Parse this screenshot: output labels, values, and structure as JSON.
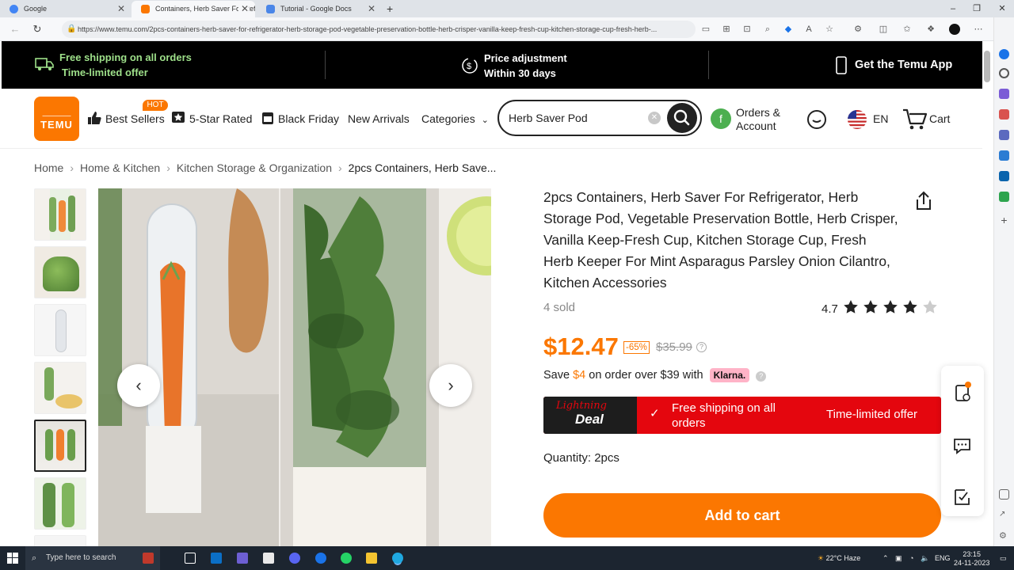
{
  "browser": {
    "tabs": [
      {
        "title": "Google",
        "favicon_color": "#4285f4",
        "active": false
      },
      {
        "title": "Containers, Herb Saver For Refrig",
        "favicon_color": "#fb7701",
        "active": true
      },
      {
        "title": "Tutorial - Google Docs",
        "favicon_color": "#4a86e8",
        "active": false
      }
    ],
    "new_tab": "+",
    "url": "https://www.temu.com/2pcs-containers-herb-saver-for-refrigerator-herb-storage-pod-vegetable-preservation-bottle-herb-crisper-vanilla-keep-fresh-cup-kitchen-storage-cup-fresh-herb-..."
  },
  "promo": {
    "shipping_title": "Free shipping on all orders",
    "shipping_sub": "Time-limited offer",
    "price_title": "Price adjustment",
    "price_sub": "Within 30 days",
    "app": "Get the Temu App"
  },
  "header": {
    "logo_top": "⸏⸏⸏",
    "logo_text": "TEMU",
    "hot_badge": "HOT",
    "nav": [
      "Best Sellers",
      "5-Star Rated",
      "Black Friday",
      "New Arrivals",
      "Categories"
    ],
    "search_value": "Herb Saver Pod",
    "orders_avatar": "f",
    "orders_label_1": "Orders &",
    "orders_label_2": "Account",
    "lang": "EN",
    "cart": "Cart"
  },
  "breadcrumb": [
    "Home",
    "Home & Kitchen",
    "Kitchen Storage & Organization",
    "2pcs Containers, Herb Save..."
  ],
  "product": {
    "title": "2pcs Containers, Herb Saver For Refrigerator, Herb Storage Pod, Vegetable Preservation Bottle, Herb Crisper, Vanilla Keep-Fresh Cup, Kitchen Storage Cup, Fresh Herb Keeper For Mint Asparagus Parsley Onion Cilantro, Kitchen Accessories",
    "sold": "4 sold",
    "rating": "4.7",
    "stars": 4.7,
    "price": "$12.47",
    "discount": "-65%",
    "original_price": "$35.99",
    "save_prefix": "Save",
    "save_amount": "$4",
    "save_suffix": "on order over $39 with",
    "klarna": "Klarna.",
    "deal_word_1": "Lightning",
    "deal_word_2": "Deal",
    "deal_text": "Free shipping on all orders",
    "deal_offer": "Time-limited offer",
    "quantity": "Quantity: 2pcs",
    "add_to_cart": "Add to cart"
  },
  "taskbar": {
    "search_placeholder": "Type here to search",
    "weather": "22°C  Haze",
    "lang": "ENG",
    "time": "23:15",
    "date": "24-11-2023"
  },
  "colors": {
    "brand": "#fb7701",
    "deal_red": "#e4060e",
    "dark": "#000000"
  }
}
